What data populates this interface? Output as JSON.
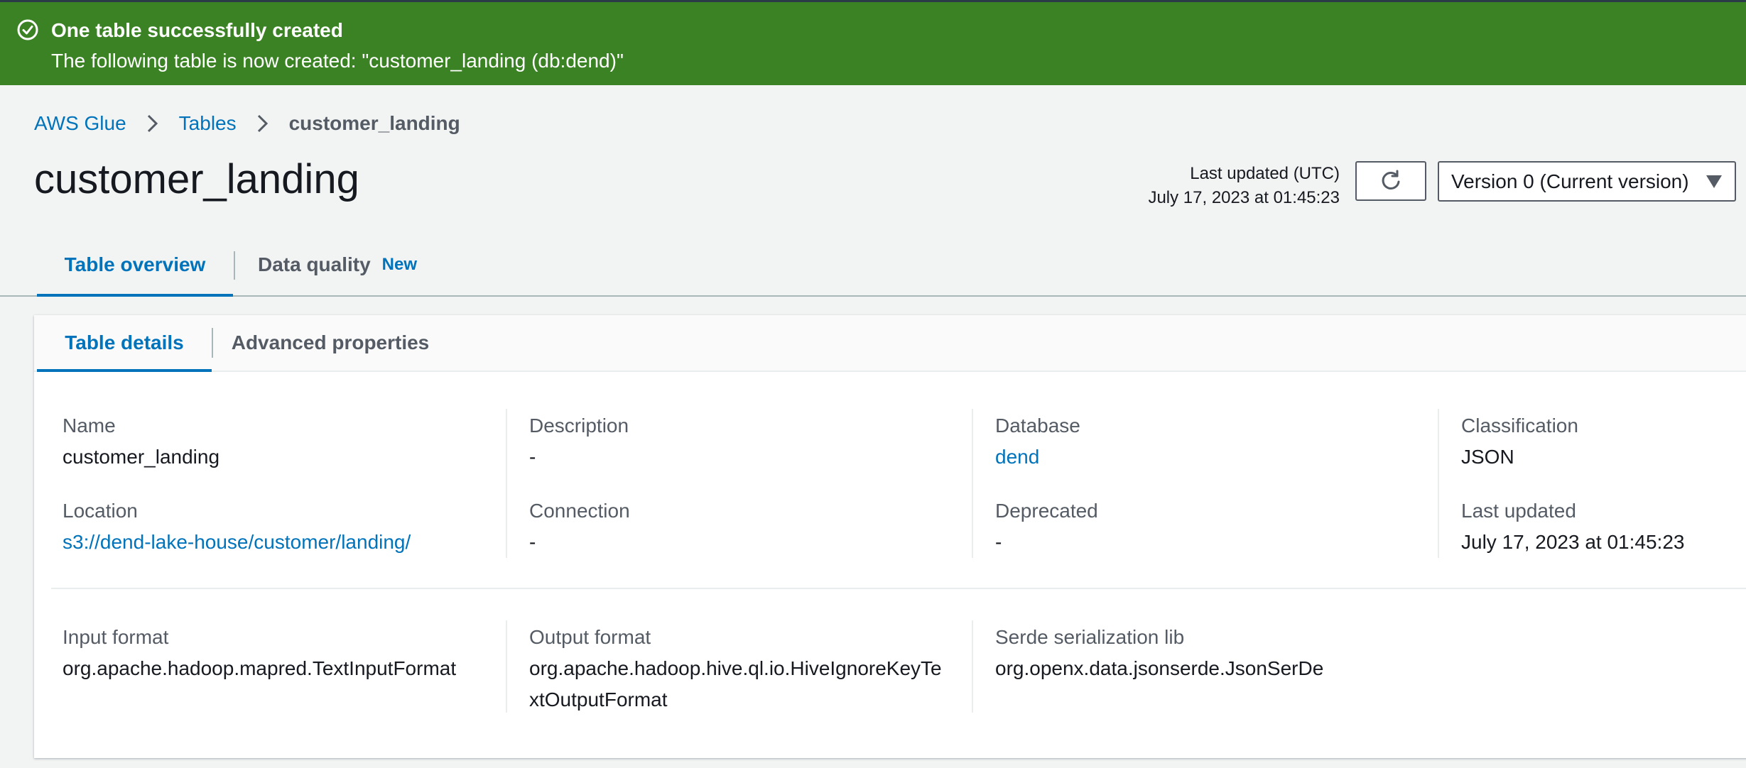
{
  "flash": {
    "title": "One table successfully created",
    "message": "The following table is now created: \"customer_landing (db:dend)\""
  },
  "breadcrumb": {
    "items": [
      "AWS Glue",
      "Tables",
      "customer_landing"
    ]
  },
  "header": {
    "title": "customer_landing",
    "last_updated_label": "Last updated (UTC)",
    "last_updated_value": "July 17, 2023 at 01:45:23",
    "version_selected": "Version 0 (Current version)"
  },
  "top_tabs": [
    {
      "label": "Table overview"
    },
    {
      "label": "Data quality",
      "badge": "New"
    }
  ],
  "sub_tabs": [
    {
      "label": "Table details"
    },
    {
      "label": "Advanced properties"
    }
  ],
  "details": {
    "name": {
      "label": "Name",
      "value": "customer_landing"
    },
    "description": {
      "label": "Description",
      "value": "-"
    },
    "database": {
      "label": "Database",
      "value": "dend"
    },
    "classification": {
      "label": "Classification",
      "value": "JSON"
    },
    "location": {
      "label": "Location",
      "value": "s3://dend-lake-house/customer/landing/"
    },
    "connection": {
      "label": "Connection",
      "value": "-"
    },
    "deprecated": {
      "label": "Deprecated",
      "value": "-"
    },
    "last_updated": {
      "label": "Last updated",
      "value": "July 17, 2023 at 01:45:23"
    },
    "input_format": {
      "label": "Input format",
      "value": "org.apache.hadoop.mapred.TextInputFormat"
    },
    "output_format": {
      "label": "Output format",
      "value_line1": "org.apache.hadoop.hive.ql.io.HiveIgnoreKeyTe",
      "value_line2": "xtOutputFormat"
    },
    "serde_lib": {
      "label": "Serde serialization lib",
      "value": "org.openx.data.jsonserde.JsonSerDe"
    }
  },
  "icons": {
    "success": "check-circle-icon",
    "breadcrumb_separator": "chevron-right-icon",
    "refresh": "refresh-icon",
    "dropdown": "caret-down-icon"
  },
  "colors": {
    "success_banner": "#3b8224",
    "link": "#0073bb",
    "text": "#16191f",
    "muted": "#545b64"
  }
}
